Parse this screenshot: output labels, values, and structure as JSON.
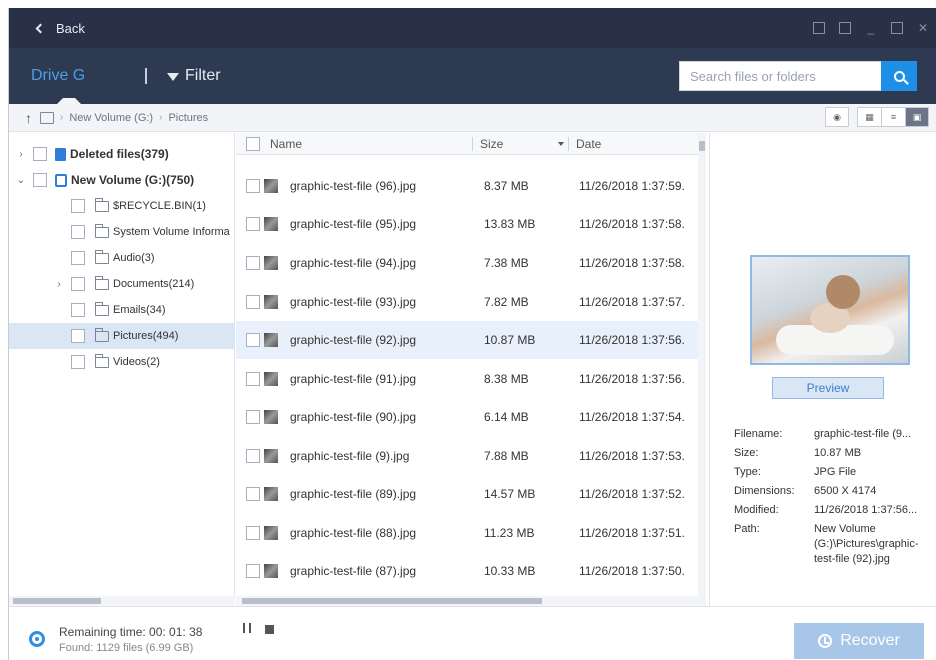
{
  "titlebar": {
    "back_label": "Back"
  },
  "toolbar": {
    "drive_tab": "Drive G",
    "filter_label": "Filter",
    "search_placeholder": "Search files or folders"
  },
  "breadcrumb": {
    "items": [
      "New Volume (G:)",
      "Pictures"
    ]
  },
  "tree": {
    "items": [
      {
        "label": "Deleted files(379)",
        "bold": true
      },
      {
        "label": "New Volume (G:)(750)",
        "bold": true
      },
      {
        "label": "$RECYCLE.BIN(1)"
      },
      {
        "label": "System Volume Informa"
      },
      {
        "label": "Audio(3)"
      },
      {
        "label": "Documents(214)"
      },
      {
        "label": "Emails(34)"
      },
      {
        "label": "Pictures(494)"
      },
      {
        "label": "Videos(2)"
      }
    ]
  },
  "filelist": {
    "columns": {
      "name": "Name",
      "size": "Size",
      "date": "Date"
    },
    "rows": [
      {
        "name": "graphic-test-file (96).jpg",
        "size": "8.37 MB",
        "date": "11/26/2018 1:37:59."
      },
      {
        "name": "graphic-test-file (95).jpg",
        "size": "13.83 MB",
        "date": "11/26/2018 1:37:58."
      },
      {
        "name": "graphic-test-file (94).jpg",
        "size": "7.38 MB",
        "date": "11/26/2018 1:37:58."
      },
      {
        "name": "graphic-test-file (93).jpg",
        "size": "7.82 MB",
        "date": "11/26/2018 1:37:57."
      },
      {
        "name": "graphic-test-file (92).jpg",
        "size": "10.87 MB",
        "date": "11/26/2018 1:37:56."
      },
      {
        "name": "graphic-test-file (91).jpg",
        "size": "8.38 MB",
        "date": "11/26/2018 1:37:56."
      },
      {
        "name": "graphic-test-file (90).jpg",
        "size": "6.14 MB",
        "date": "11/26/2018 1:37:54."
      },
      {
        "name": "graphic-test-file (9).jpg",
        "size": "7.88 MB",
        "date": "11/26/2018 1:37:53."
      },
      {
        "name": "graphic-test-file (89).jpg",
        "size": "14.57 MB",
        "date": "11/26/2018 1:37:52."
      },
      {
        "name": "graphic-test-file (88).jpg",
        "size": "11.23 MB",
        "date": "11/26/2018 1:37:51."
      },
      {
        "name": "graphic-test-file (87).jpg",
        "size": "10.33 MB",
        "date": "11/26/2018 1:37:50."
      }
    ]
  },
  "preview": {
    "button_label": "Preview",
    "meta": {
      "filename_label": "Filename:",
      "filename": "graphic-test-file (9...",
      "size_label": "Size:",
      "size": "10.87 MB",
      "type_label": "Type:",
      "type": "JPG File",
      "dimensions_label": "Dimensions:",
      "dimensions": "6500 X 4174",
      "modified_label": "Modified:",
      "modified": "11/26/2018 1:37:56...",
      "path_label": "Path:",
      "path": "New Volume (G:)\\Pictures\\graphic-test-file (92).jpg"
    }
  },
  "status": {
    "remaining": "Remaining time: 00: 01: 38",
    "found": "Found: 1129 files (6.99 GB)",
    "recover_label": "Recover"
  }
}
